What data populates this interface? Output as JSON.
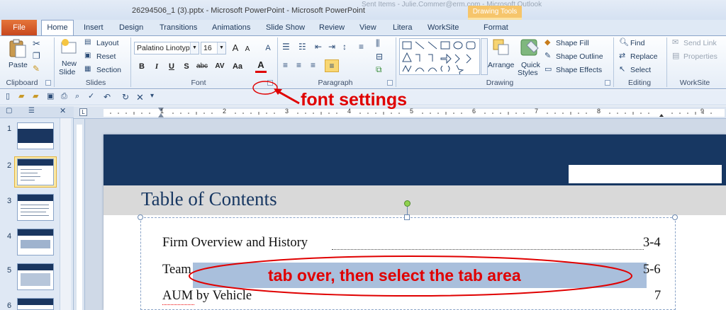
{
  "window": {
    "title": "26294506_1 (3).pptx - Microsoft PowerPoint  -  Microsoft PowerPoint",
    "behind_title": "Sent Items - Julie.Commer@erm.com - Microsoft Outlook",
    "contextual_tab_group": "Drawing Tools"
  },
  "tabs": [
    "File",
    "Home",
    "Insert",
    "Design",
    "Transitions",
    "Animations",
    "Slide Show",
    "Review",
    "View",
    "Litera",
    "WorkSite",
    "Format"
  ],
  "ribbon": {
    "clipboard": {
      "paste": "Paste",
      "label": "Clipboard"
    },
    "slides": {
      "new_slide_1": "New",
      "new_slide_2": "Slide",
      "layout": "Layout",
      "reset": "Reset",
      "section": "Section",
      "label": "Slides"
    },
    "font": {
      "name": "Palatino Linotype",
      "size": "16",
      "bold": "B",
      "italic": "I",
      "underline": "U",
      "shadow": "S",
      "strike": "abc",
      "spacing": "AV",
      "case": "Aa",
      "color": "A",
      "grow": "A",
      "shrink": "A",
      "clear": "A",
      "label": "Font"
    },
    "paragraph": {
      "label": "Paragraph"
    },
    "drawing": {
      "arrange": "Arrange",
      "quick_styles_1": "Quick",
      "quick_styles_2": "Styles",
      "shape_fill": "Shape Fill",
      "shape_outline": "Shape Outline",
      "shape_effects": "Shape Effects",
      "label": "Drawing"
    },
    "editing": {
      "find": "Find",
      "replace": "Replace",
      "select": "Select",
      "label": "Editing"
    },
    "worksite": {
      "send_link": "Send Link",
      "properties": "Properties",
      "label": "WorkSite"
    }
  },
  "slides_pane": {
    "numbers": [
      "1",
      "2",
      "3",
      "4",
      "5",
      "6"
    ]
  },
  "slide": {
    "title": "Table of Contents",
    "toc": [
      {
        "text": "Firm Overview and History",
        "page": "3-4"
      },
      {
        "text": "Team",
        "page": "5-6"
      },
      {
        "text": "AUM by Vehicle",
        "page": "7"
      }
    ]
  },
  "annotations": {
    "font_settings": "font settings",
    "tab_note": "tab over, then select the tab area"
  },
  "ruler": {
    "numbers": [
      "1",
      "2",
      "3",
      "4",
      "5",
      "6",
      "7",
      "8",
      "9"
    ]
  },
  "colors": {
    "file_tab": "#d1521f",
    "slide_header": "#173762",
    "annotation_red": "#e00000",
    "selection_highlight": "#a9bfdc"
  }
}
